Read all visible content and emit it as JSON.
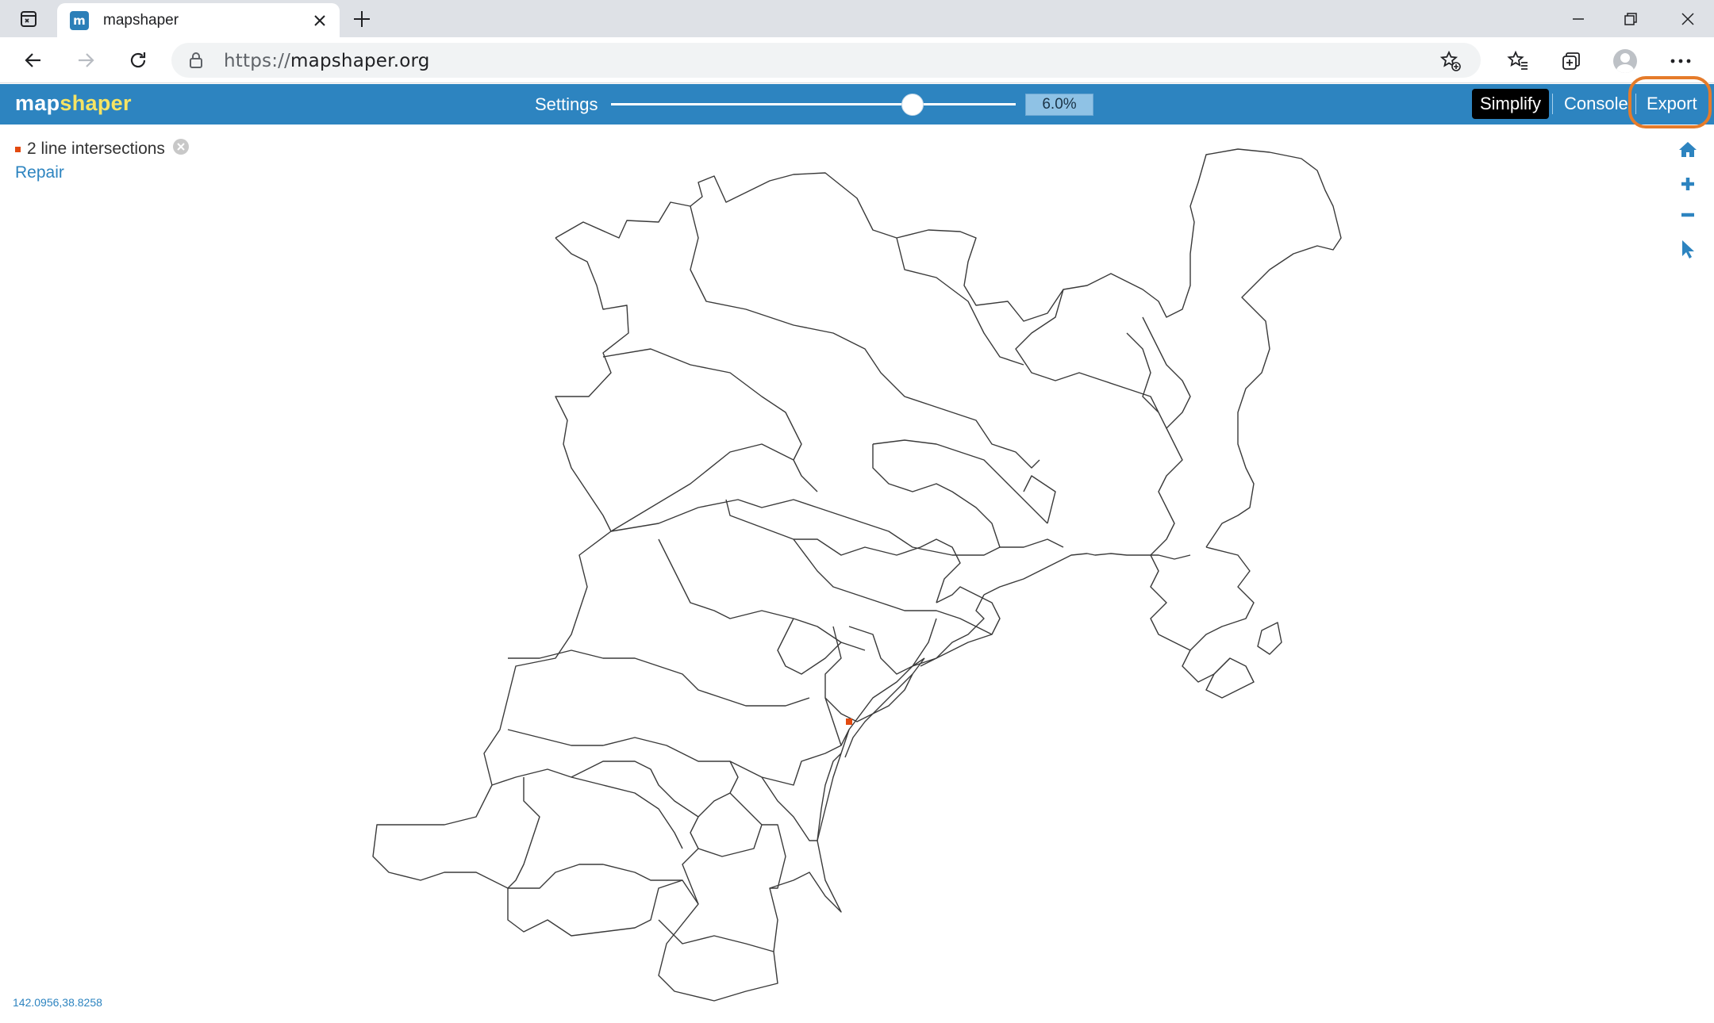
{
  "browser": {
    "tab_title": "mapshaper",
    "favicon_text": "m",
    "url_scheme": "https://",
    "url_host": "mapshaper.org"
  },
  "app": {
    "logo_part1": "map",
    "logo_part2": "shaper",
    "settings_label": "Settings",
    "simplify_percent": "6.0%",
    "slider_level": 0.745,
    "buttons": {
      "simplify": "Simplify",
      "console": "Console",
      "export": "Export"
    },
    "accent_color": "#2d84c0",
    "highlight_color": "#e57b2a"
  },
  "map": {
    "message": "2 line intersections",
    "repair_link": "Repair",
    "coordinates": "142.0956,38.8258",
    "tools": [
      "home-icon",
      "zoom-in-icon",
      "zoom-out-icon",
      "pointer-icon"
    ]
  }
}
